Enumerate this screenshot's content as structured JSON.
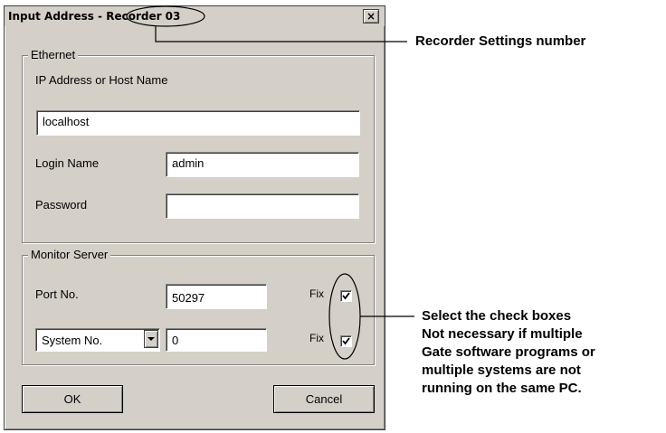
{
  "dialog": {
    "title_prefix": "Input Address - ",
    "title_highlight": "Recorder 03",
    "close_label": "×"
  },
  "ethernet": {
    "legend": "Ethernet",
    "host_label": "IP Address or Host Name",
    "host_value": "localhost",
    "login_label": "Login Name",
    "login_value": "admin",
    "password_label": "Password",
    "password_value": ""
  },
  "monitor": {
    "legend": "Monitor Server",
    "port_label": "Port No.",
    "port_value": "50297",
    "port_fix_label": "Fix",
    "port_fix_checked": true,
    "select_value": "System No.",
    "system_value": "0",
    "system_fix_label": "Fix",
    "system_fix_checked": true
  },
  "buttons": {
    "ok": "OK",
    "cancel": "Cancel"
  },
  "callouts": {
    "recorder_settings": "Recorder Settings number",
    "check_lines": [
      "Select the check boxes",
      "Not necessary if multiple",
      "Gate software programs or",
      "multiple systems are not",
      "running on the same PC."
    ]
  },
  "colors": {
    "dialog_face": "#d4d0c8",
    "field_bg": "#ffffff"
  }
}
